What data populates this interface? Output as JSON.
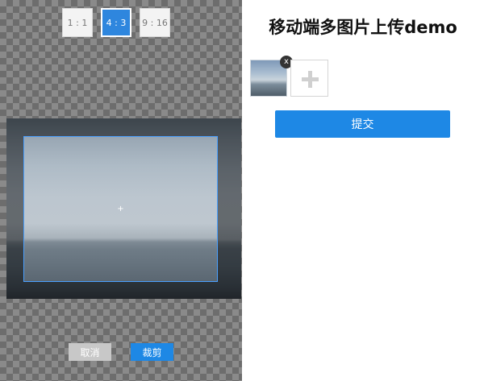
{
  "cropper": {
    "ratios": [
      {
        "label": "1 : 1",
        "selected": false
      },
      {
        "label": "4 : 3",
        "selected": true
      },
      {
        "label": "9 : 16",
        "selected": false
      }
    ],
    "center_marker": "+",
    "cancel_label": "取消",
    "crop_label": "裁剪"
  },
  "page": {
    "title": "移动端多图片上传demo",
    "remove_label": "x",
    "submit_label": "提交"
  },
  "colors": {
    "accent": "#1e88e5",
    "selected_ratio": "#2e86de",
    "cancel_bg": "#c8c8c8"
  }
}
